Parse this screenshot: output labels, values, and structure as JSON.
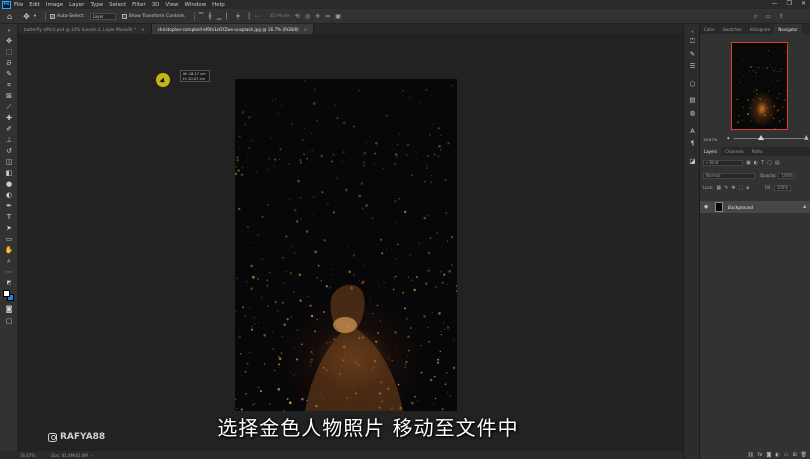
{
  "app": {
    "logo_text": "Ps"
  },
  "menu": [
    "File",
    "Edit",
    "Image",
    "Layer",
    "Type",
    "Select",
    "Filter",
    "3D",
    "View",
    "Window",
    "Help"
  ],
  "window_controls": {
    "minimize": "—",
    "maximize": "❐",
    "close": "✕"
  },
  "options_bar": {
    "auto_select_label": "Auto-Select:",
    "auto_select_value": "Layer",
    "show_transform_label": "Show Transform Controls",
    "mode_3d_label": "3D Mode:"
  },
  "tabs": [
    {
      "label": "butterfly effect.psd @ 33% (Levels 2, Layer Mask/8) *",
      "active": false
    },
    {
      "label": "christopher-campbell-kf6fa1zGYZws-unsplash.jpg @ 16.7% (RGB/8)",
      "active": true
    }
  ],
  "measure_tooltip": {
    "x": "W: 18.27 cm",
    "y": "H: 20.07 cm"
  },
  "caption": "选择金色人物照片 移动至文件中",
  "watermark": "RAFYA88",
  "status": {
    "zoom": "16.67%",
    "doc": "Doc: 41.4M/41.4M"
  },
  "right_panel": {
    "top_tabs": [
      "Color",
      "Swatches",
      "Histogram",
      "Navigator"
    ],
    "active_top_tab": "Navigator",
    "nav_zoom": "16.67%",
    "layer_tabs": [
      "Layers",
      "Channels",
      "Paths"
    ],
    "active_layer_tab": "Layers",
    "kind_label": "Kind",
    "blend_mode": "Normal",
    "opacity_label": "Opacity:",
    "opacity_value": "100%",
    "lock_label": "Lock:",
    "fill_label": "Fill:",
    "fill_value": "100%",
    "layers": [
      {
        "name": "Background",
        "visible": true,
        "locked": true
      }
    ]
  },
  "colors": {
    "foreground": "#ffffff",
    "background": "#1d86e8",
    "nav_frame": "#e2392d",
    "cursor": "#d4c51a"
  }
}
